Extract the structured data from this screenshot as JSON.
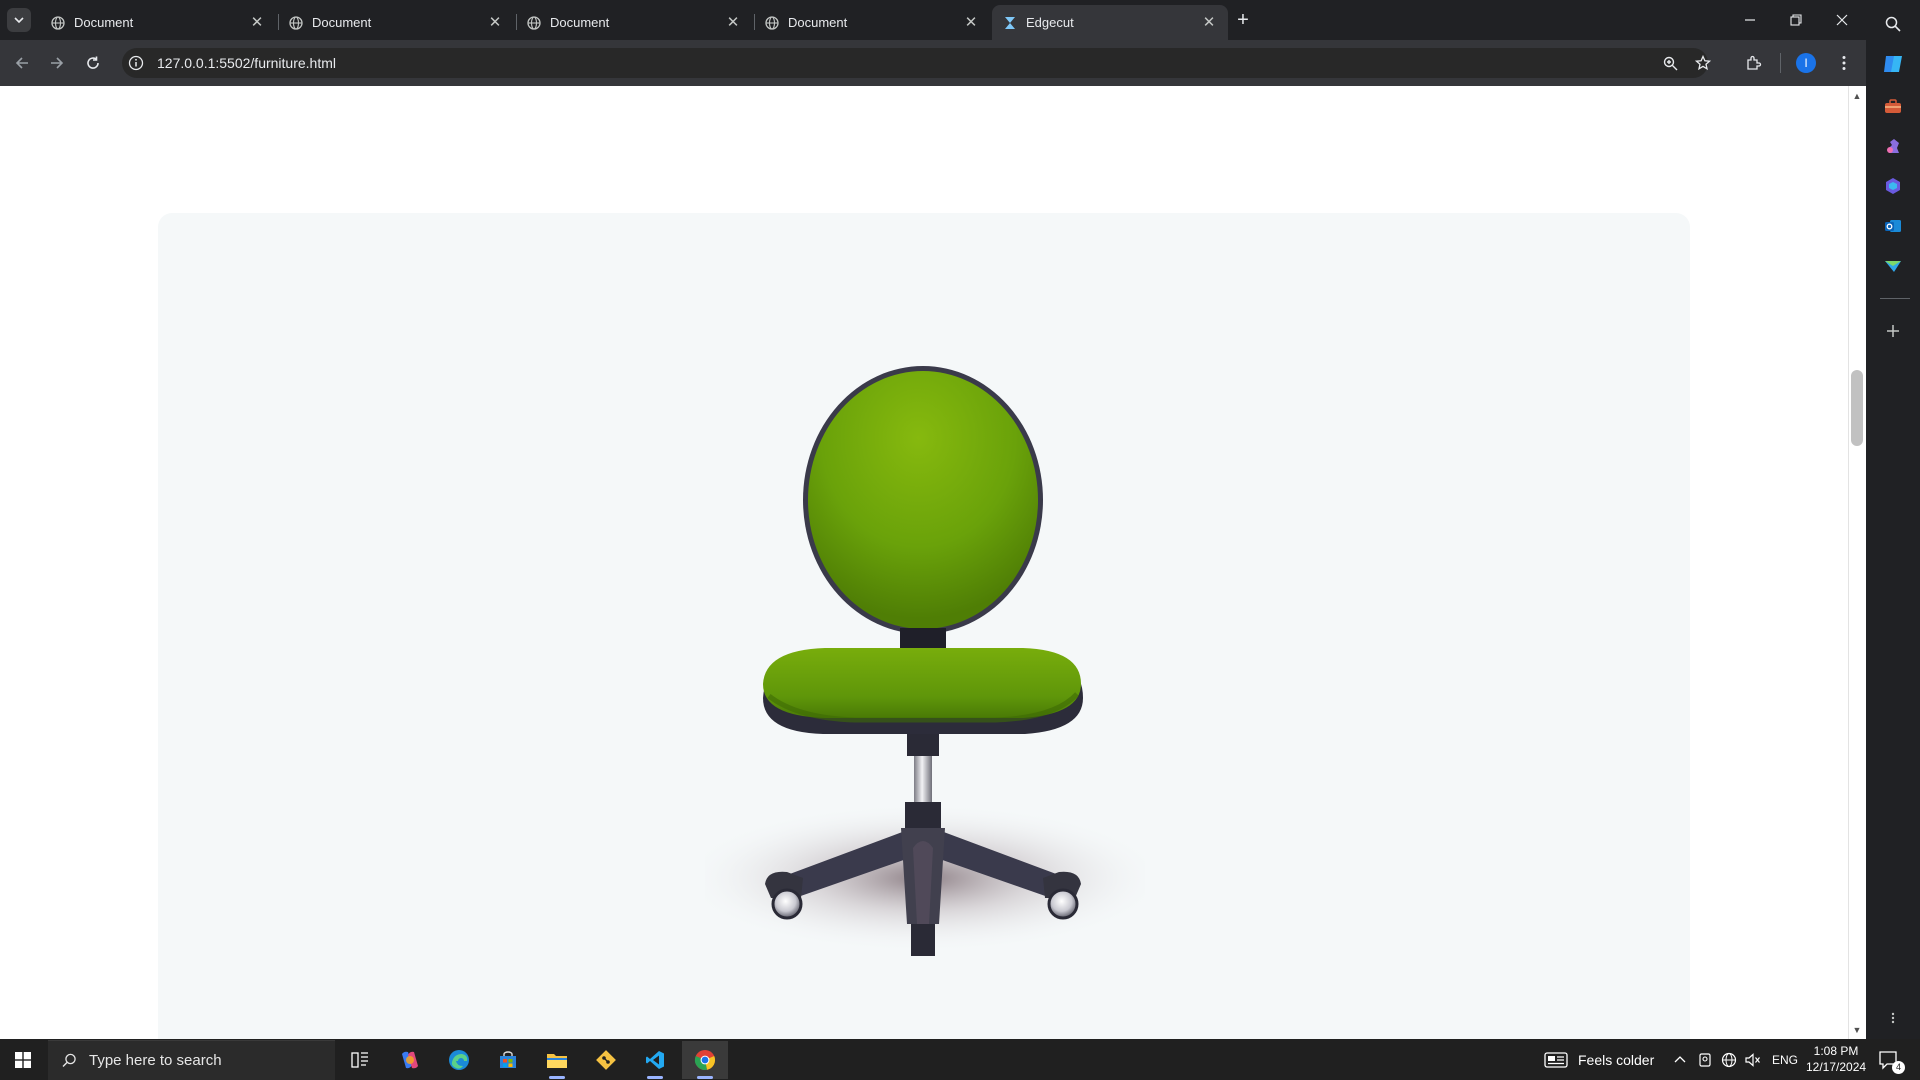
{
  "browser": {
    "tabs": [
      {
        "label": "Document",
        "favicon": "globe-icon",
        "active": false
      },
      {
        "label": "Document",
        "favicon": "globe-icon",
        "active": false
      },
      {
        "label": "Document",
        "favicon": "globe-icon",
        "active": false
      },
      {
        "label": "Document",
        "favicon": "globe-icon",
        "active": false
      },
      {
        "label": "Edgecut",
        "favicon": "hourglass-icon",
        "active": true
      }
    ],
    "new_tab_glyph": "+",
    "tab_close_glyph": "✕",
    "address": "127.0.0.1:5502/furniture.html",
    "profile_initial": "I",
    "accent": "#1a73e8"
  },
  "page": {
    "background": "#ffffff",
    "card_background": "#f5f8f9",
    "chair": {
      "seat_color": "#6aa20a",
      "frame_color": "#2e2e3c"
    }
  },
  "taskbar": {
    "search_placeholder": "Type here to search",
    "weather": "Feels colder",
    "language": "ENG",
    "time": "1:08 PM",
    "date": "12/17/2024",
    "notification_count": "4"
  }
}
